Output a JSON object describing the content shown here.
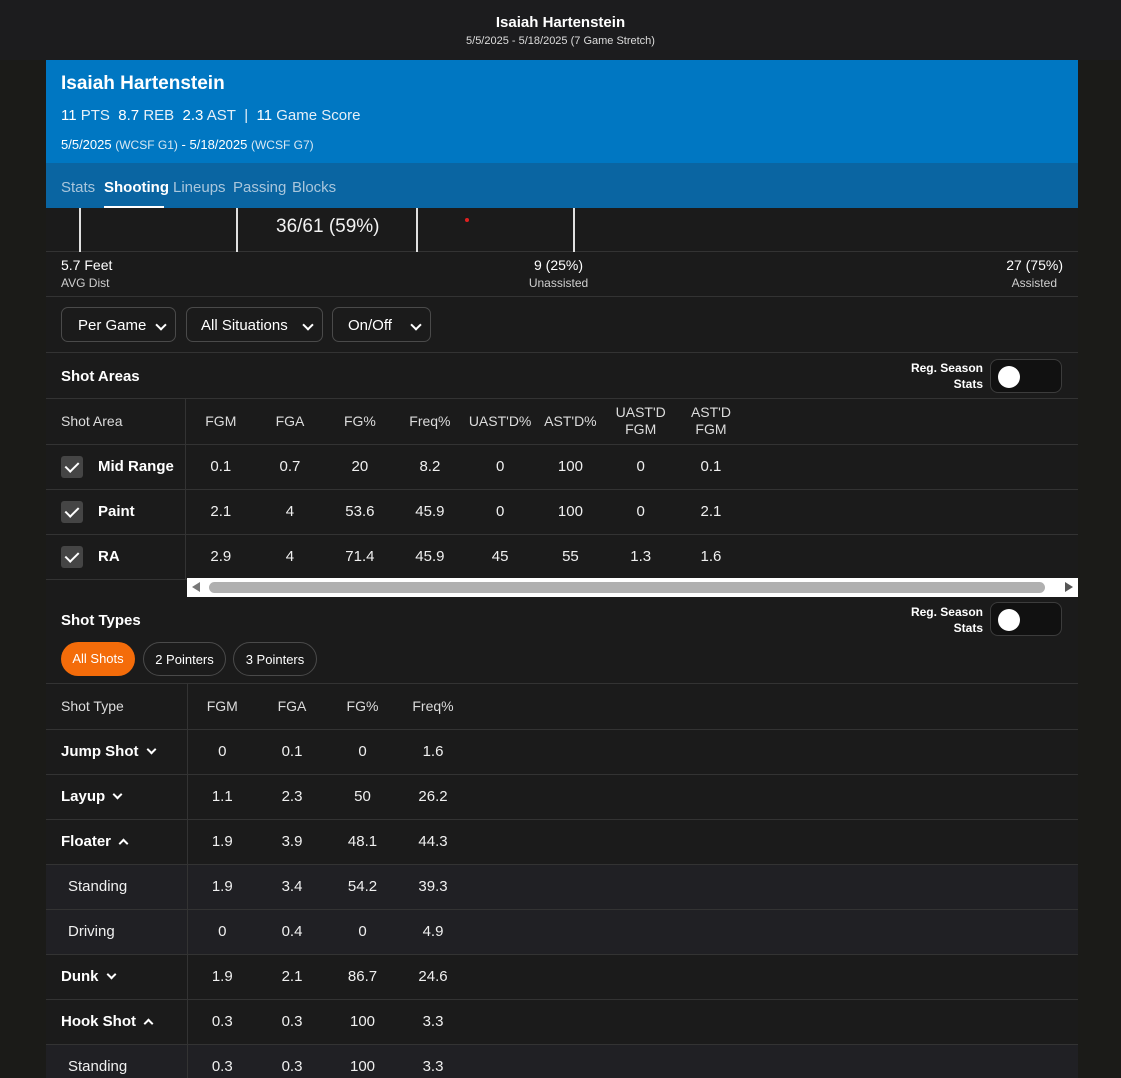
{
  "header": {
    "title": "Isaiah Hartenstein",
    "subtitle": "5/5/2025 - 5/18/2025 (7 Game Stretch)"
  },
  "player": {
    "name": "Isaiah Hartenstein",
    "pts": "11",
    "pts_label": "PTS",
    "reb": "8.7",
    "reb_label": "REB",
    "ast": "2.3",
    "ast_label": "AST",
    "divider": "|",
    "game_score": "11",
    "game_score_label": "Game Score",
    "date_start": "5/5/2025",
    "date_start_sub": "(WCSF G1)",
    "date_sep": "-",
    "date_end": "5/18/2025",
    "date_end_sub": "(WCSF G7)"
  },
  "tabs": [
    {
      "label": "Stats",
      "active": false
    },
    {
      "label": "Shooting",
      "active": true
    },
    {
      "label": "Lineups",
      "active": false
    },
    {
      "label": "Passing",
      "active": false
    },
    {
      "label": "Blocks",
      "active": false
    }
  ],
  "shot_chart": {
    "fg_summary": "36/61 (59%)"
  },
  "metrics": {
    "avg_dist": {
      "value": "5.7 Feet",
      "label": "AVG Dist"
    },
    "unassisted": {
      "value": "9 (25%)",
      "label": "Unassisted"
    },
    "assisted": {
      "value": "27 (75%)",
      "label": "Assisted"
    }
  },
  "filters": {
    "per_game": "Per Game",
    "situations": "All Situations",
    "on_off": "On/Off"
  },
  "shot_areas": {
    "title": "Shot Areas",
    "reg_season_line1": "Reg. Season",
    "reg_season_line2": "Stats",
    "reg_season_on": false,
    "columns": [
      "Shot Area",
      "FGM",
      "FGA",
      "FG%",
      "Freq%",
      "UAST'D%",
      "AST'D%",
      "UAST'D FGM",
      "AST'D FGM"
    ],
    "rows": [
      {
        "label": "Mid Range",
        "checked": true,
        "values": [
          "0.1",
          "0.7",
          "20",
          "8.2",
          "0",
          "100",
          "0",
          "0.1"
        ]
      },
      {
        "label": "Paint",
        "checked": true,
        "values": [
          "2.1",
          "4",
          "53.6",
          "45.9",
          "0",
          "100",
          "0",
          "2.1"
        ]
      },
      {
        "label": "RA",
        "checked": true,
        "values": [
          "2.9",
          "4",
          "71.4",
          "45.9",
          "45",
          "55",
          "1.3",
          "1.6"
        ]
      }
    ]
  },
  "shot_types": {
    "title": "Shot Types",
    "reg_season_line1": "Reg. Season",
    "reg_season_line2": "Stats",
    "reg_season_on": false,
    "pills": [
      {
        "label": "All Shots",
        "active": true
      },
      {
        "label": "2 Pointers",
        "active": false
      },
      {
        "label": "3 Pointers",
        "active": false
      }
    ],
    "columns": [
      "Shot Type",
      "FGM",
      "FGA",
      "FG%",
      "Freq%"
    ],
    "rows": [
      {
        "label": "Jump Shot",
        "expand": "down",
        "sub": false,
        "values": [
          "0",
          "0.1",
          "0",
          "1.6"
        ]
      },
      {
        "label": "Layup",
        "expand": "down",
        "sub": false,
        "values": [
          "1.1",
          "2.3",
          "50",
          "26.2"
        ]
      },
      {
        "label": "Floater",
        "expand": "up",
        "sub": false,
        "values": [
          "1.9",
          "3.9",
          "48.1",
          "44.3"
        ]
      },
      {
        "label": "Standing",
        "expand": "",
        "sub": true,
        "values": [
          "1.9",
          "3.4",
          "54.2",
          "39.3"
        ]
      },
      {
        "label": "Driving",
        "expand": "",
        "sub": true,
        "values": [
          "0",
          "0.4",
          "0",
          "4.9"
        ]
      },
      {
        "label": "Dunk",
        "expand": "down",
        "sub": false,
        "values": [
          "1.9",
          "2.1",
          "86.7",
          "24.6"
        ]
      },
      {
        "label": "Hook Shot",
        "expand": "up",
        "sub": false,
        "values": [
          "0.3",
          "0.3",
          "100",
          "3.3"
        ]
      },
      {
        "label": "Standing",
        "expand": "",
        "sub": true,
        "values": [
          "0.3",
          "0.3",
          "100",
          "3.3"
        ]
      }
    ]
  },
  "colors": {
    "header_blue": "#0077c2",
    "tab_bar_blue": "#0a65a2",
    "accent_orange": "#f46c0a",
    "background": "#1b1b18"
  }
}
